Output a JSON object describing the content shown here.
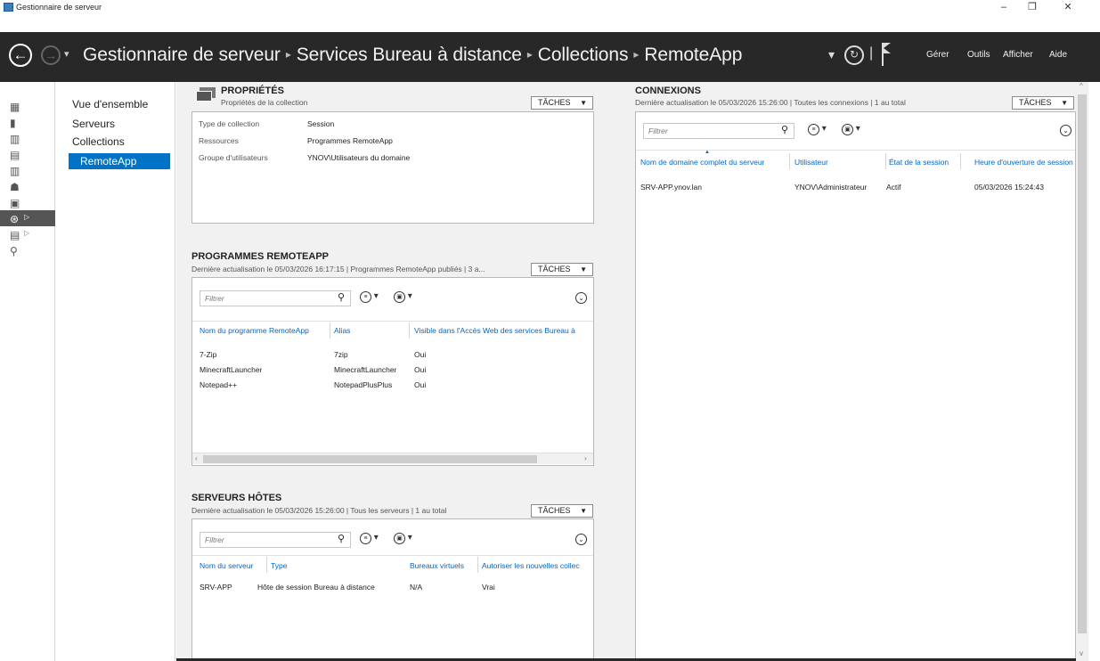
{
  "window": {
    "title": "Gestionnaire de serveur",
    "minimize": "–",
    "maximize": "❐",
    "close": "✕"
  },
  "header": {
    "back": "←",
    "forward": "→",
    "dropdown": "▾",
    "breadcrumb": [
      "Gestionnaire de serveur",
      "Services Bureau à distance",
      "Collections",
      "RemoteApp"
    ],
    "separator": "▸",
    "dropdown2": "▾",
    "refresh": "↻",
    "divider": "|",
    "menu": [
      "Gérer",
      "Outils",
      "Afficher",
      "Aide"
    ]
  },
  "left_nav": {
    "items": [
      {
        "icon": "dashboard-icon",
        "glyph": "▦"
      },
      {
        "icon": "server-icon",
        "glyph": "▮"
      },
      {
        "icon": "servers-icon",
        "glyph": "▥"
      },
      {
        "icon": "file-storage-icon",
        "glyph": "▤"
      },
      {
        "icon": "iis-icon",
        "glyph": "▥"
      },
      {
        "icon": "remote-desktop-icon",
        "glyph": "☗"
      },
      {
        "icon": "remoteapp-icon",
        "glyph": "▣"
      },
      {
        "icon": "rds-icon",
        "glyph": "⊛",
        "selected": true,
        "arrow": "▷"
      },
      {
        "icon": "wsus-icon",
        "glyph": "▤",
        "arrow": "▷"
      },
      {
        "icon": "tools-icon",
        "glyph": "⚲"
      }
    ]
  },
  "sub_nav": {
    "items": [
      "Vue d'ensemble",
      "Serveurs",
      "Collections",
      "RemoteApp"
    ],
    "selected": "RemoteApp"
  },
  "properties": {
    "title": "PROPRIÉTÉS",
    "subtitle": "Propriétés de la collection",
    "tasks": "TÂCHES",
    "rows": [
      {
        "key": "Type de collection",
        "value": "Session"
      },
      {
        "key": "Ressources",
        "value": "Programmes RemoteApp"
      },
      {
        "key": "Groupe d'utilisateurs",
        "value": "YNOV\\Utilisateurs du domaine"
      }
    ]
  },
  "remoteapp": {
    "title": "PROGRAMMES REMOTEAPP",
    "subtitle": "Dernière actualisation le 05/03/2026 16:17:15 | Programmes RemoteApp publiés | 3 a...",
    "tasks": "TÂCHES",
    "filter_placeholder": "Filtrer",
    "columns": [
      "Nom du programme RemoteApp",
      "Alias",
      "Visible dans l'Accès Web des services Bureau à"
    ],
    "rows": [
      [
        "7-Zip",
        "7zip",
        "Oui"
      ],
      [
        "MinecraftLauncher",
        "MinecraftLauncher",
        "Oui"
      ],
      [
        "Notepad++",
        "NotepadPlusPlus",
        "Oui"
      ]
    ]
  },
  "hosts": {
    "title": "SERVEURS HÔTES",
    "subtitle": "Dernière actualisation le 05/03/2026 15:26:00 | Tous les serveurs | 1 au total",
    "tasks": "TÂCHES",
    "filter_placeholder": "Filtrer",
    "columns": [
      "Nom du serveur",
      "Type",
      "Bureaux virtuels",
      "Autoriser les nouvelles collec"
    ],
    "rows": [
      [
        "SRV-APP",
        "Hôte de session Bureau à distance",
        "N/A",
        "Vrai"
      ]
    ]
  },
  "connections": {
    "title": "CONNEXIONS",
    "subtitle": "Dernière actualisation le 05/03/2026 15:26:00 | Toutes les connexions | 1 au total",
    "tasks": "TÂCHES",
    "filter_placeholder": "Filtrer",
    "columns": [
      "Nom de domaine complet du serveur",
      "Utilisateur",
      "État de la session",
      "Heure d'ouverture de session"
    ],
    "rows": [
      [
        "SRV-APP.ynov.lan",
        "YNOV\\Administrateur",
        "Actif",
        "05/03/2026 15:24:43"
      ]
    ]
  },
  "colors": {
    "header_bg": "#282828",
    "selection": "#0073c6",
    "link": "#0066cc"
  }
}
